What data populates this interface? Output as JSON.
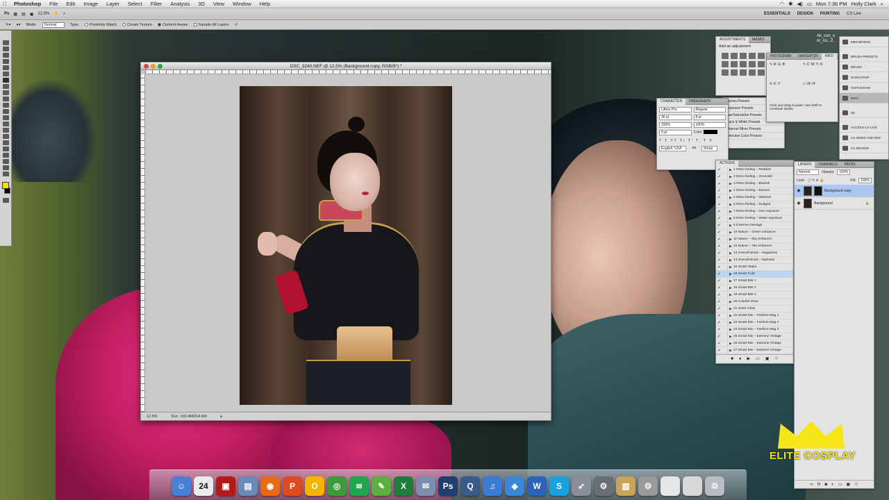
{
  "menubar": {
    "apple": "",
    "app": "Photoshop",
    "items": [
      "File",
      "Edit",
      "Image",
      "Layer",
      "Select",
      "Filter",
      "Analysis",
      "3D",
      "View",
      "Window",
      "Help"
    ],
    "clock": "Mon 7:36 PM",
    "user": "Holly Clark"
  },
  "options": {
    "zoom": "12.5%",
    "workspaces": [
      "ESSENTIALS",
      "DESIGN",
      "PAINTING"
    ],
    "cs_live": "CS Live",
    "mode_label": "Mode:",
    "mode_value": "Normal",
    "type_label": "Type:",
    "proximity": "Proximity Match",
    "create_texture": "Create Texture",
    "content_aware": "Content-Aware",
    "sample_all": "Sample All Layers"
  },
  "document": {
    "title": "DSC_3240.NEF @ 12.5% (Background copy, RGB/8*) *",
    "zoom": "12.5%",
    "doc_size": "Doc: 103.4M/214.6M"
  },
  "adjustments": {
    "tabs": [
      "ADJUSTMENTS",
      "MASKS"
    ],
    "subtitle": "Add an adjustment"
  },
  "character": {
    "tabs": [
      "CHARACTER",
      "PARAGRAPH"
    ],
    "font": "Lithos Pro",
    "style": "Regular",
    "size": "36 pt",
    "leading": "8 pt",
    "tracking": "100%",
    "kerning": "100%",
    "baseline": "0 pt",
    "color_label": "Color:",
    "language": "English: USA",
    "aa_label": "aa",
    "aa_value": "Sharp"
  },
  "presets": [
    "Curves Presets",
    "Exposure Presets",
    "Hue/Saturation Presets",
    "Black & White Presets",
    "Channel Mixer Presets",
    "Selective Color Presets"
  ],
  "info": {
    "tabs": [
      "HISTOGRAM",
      "NAVIGATOR",
      "INFO"
    ],
    "hint": "Click and drag to paint. Use Shift to constrain stroke."
  },
  "actions": {
    "tab": "ACTIONS",
    "items": [
      "1 Retro feeling – Reddish",
      "2 Retro feeling – Greenish",
      "3 Retro feeling – Blueish",
      "4 Retro feeling – Burned",
      "5 Retro feeling – Washed",
      "6 Retro feeling – Dodged",
      "7 Retro feeling – Sun exposure",
      "8 Retro feeling – Water exposure",
      "9 Extreme Damage",
      "10 Nature – Green enhancer",
      "11 Nature – Sky enhancer",
      "12 Nature – Tan enhancer",
      "13 Overall Mood – Happiness",
      "14 Overall Mood – Sadness",
      "15 Smart Sepia",
      "16 Smart Cold",
      "17 Smart BW 1",
      "18 Smart BW 2",
      "19 Smart BW 3",
      "20 Colorful Glow",
      "21 Gloss Glow",
      "22 Smart Mix – Fashion Mag 1",
      "23 Smart Mix – Fashion Mag 2",
      "24 Smart Mix – Fashion Mag 3",
      "25 Smart Mix – Extreme Vintage",
      "26 Smart Mix – Extreme Vintage",
      "27 Smart Mix – Extreme Vintage"
    ],
    "selected_index": 15
  },
  "layers": {
    "tabs": [
      "LAYERS",
      "CHANNELS",
      "PATHS"
    ],
    "blend": "Normal",
    "opacity_label": "Opacity:",
    "opacity": "100%",
    "lock_label": "Lock:",
    "fill_label": "Fill:",
    "fill": "100%",
    "items": [
      {
        "name": "Background copy",
        "selected": true
      },
      {
        "name": "Background",
        "selected": false
      }
    ]
  },
  "mini_panels": [
    {
      "label": "MINI BRIDGE",
      "selected": false
    },
    {
      "label": "BRUSH PRESETS",
      "selected": false
    },
    {
      "label": "BRUSH",
      "selected": false
    },
    {
      "label": "NAVIGATOR",
      "selected": false
    },
    {
      "label": "HISTOGRAM",
      "selected": false
    },
    {
      "label": "INFO",
      "selected": true
    },
    {
      "label": "3D",
      "selected": false
    },
    {
      "label": "ACCESS CS LIVE",
      "selected": false
    },
    {
      "label": "CS NEWS AND RES",
      "selected": false
    },
    {
      "label": "CS REVIEW",
      "selected": false
    }
  ],
  "desktop_file": "Ali_con_v or_co...2.",
  "watermark": "ELITE COSPLAY",
  "dock": {
    "calendar_day": "24",
    "apps": [
      {
        "name": "finder",
        "color": "#4a7fd6",
        "glyph": "☺"
      },
      {
        "name": "calendar",
        "color": "#eaeaea",
        "glyph": ""
      },
      {
        "name": "photo-booth",
        "color": "#b31b1b",
        "glyph": "▣"
      },
      {
        "name": "iphoto",
        "color": "#6a8bb5",
        "glyph": "▤"
      },
      {
        "name": "firefox",
        "color": "#e76b15",
        "glyph": "◉"
      },
      {
        "name": "app-p",
        "color": "#e04a1f",
        "glyph": "P"
      },
      {
        "name": "app-o",
        "color": "#f4b400",
        "glyph": "O"
      },
      {
        "name": "chrome",
        "color": "#3b9b3d",
        "glyph": "◎"
      },
      {
        "name": "spotify",
        "color": "#1ea64a",
        "glyph": "≋"
      },
      {
        "name": "evernote",
        "color": "#5cae3e",
        "glyph": "✎"
      },
      {
        "name": "excel",
        "color": "#1f7d3a",
        "glyph": "X"
      },
      {
        "name": "preview",
        "color": "#7b8fb2",
        "glyph": "✉"
      },
      {
        "name": "photoshop",
        "color": "#1f3f6e",
        "glyph": "Ps"
      },
      {
        "name": "quicktime",
        "color": "#3a5a8a",
        "glyph": "Q"
      },
      {
        "name": "itunes",
        "color": "#3b7bd5",
        "glyph": "♫"
      },
      {
        "name": "safari",
        "color": "#3a86d6",
        "glyph": "◈"
      },
      {
        "name": "word",
        "color": "#2a63b8",
        "glyph": "W"
      },
      {
        "name": "skype",
        "color": "#1aa1e0",
        "glyph": "S"
      },
      {
        "name": "launchpad",
        "color": "#8a8f99",
        "glyph": "➶"
      },
      {
        "name": "system-preferences",
        "color": "#6b6e74",
        "glyph": "⚙"
      },
      {
        "name": "contacts",
        "color": "#c8a45a",
        "glyph": "▥"
      },
      {
        "name": "settings",
        "color": "#9a9a9a",
        "glyph": "⚙"
      },
      {
        "name": "documents",
        "color": "#e6e6e6",
        "glyph": ""
      },
      {
        "name": "downloads",
        "color": "#d8d8d8",
        "glyph": ""
      },
      {
        "name": "trash",
        "color": "#b9bcc0",
        "glyph": "♲"
      }
    ]
  }
}
